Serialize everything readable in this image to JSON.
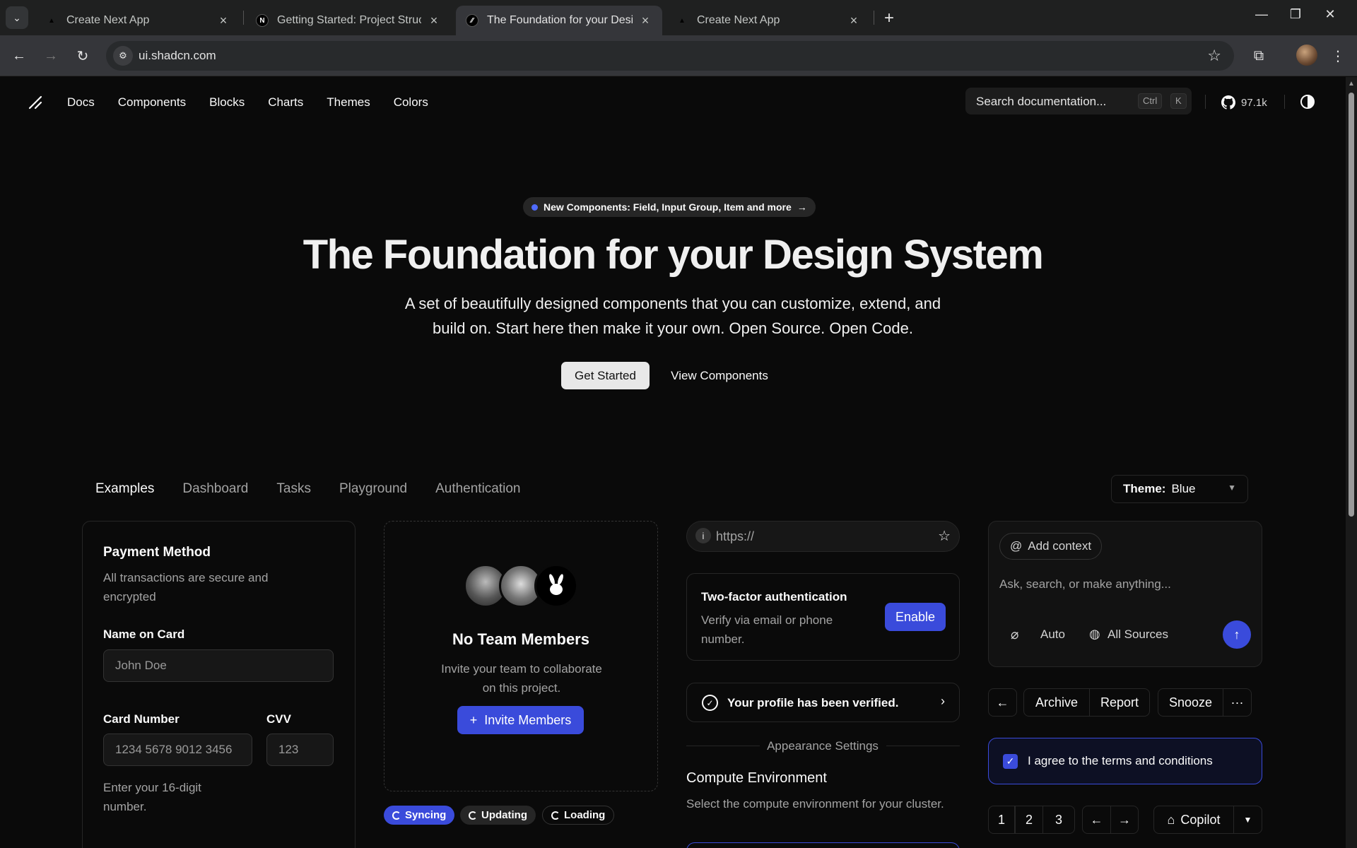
{
  "browser": {
    "tabs": [
      {
        "title": "Create Next App"
      },
      {
        "title": "Getting Started: Project Structure"
      },
      {
        "title": "The Foundation for your Design System"
      },
      {
        "title": "Create Next App"
      }
    ],
    "url": "ui.shadcn.com"
  },
  "site": {
    "nav": [
      "Docs",
      "Components",
      "Blocks",
      "Charts",
      "Themes",
      "Colors"
    ],
    "search_placeholder": "Search documentation...",
    "kbd_ctrl": "Ctrl",
    "kbd_k": "K",
    "github_stars": "97.1k"
  },
  "hero": {
    "announcement": "New Components: Field, Input Group, Item and more",
    "title": "The Foundation for your Design System",
    "subtitle": "A set of beautifully designed components that you can customize, extend, and build on. Start here then make it your own. Open Source. Open Code.",
    "primary_cta": "Get Started",
    "secondary_cta": "View Components"
  },
  "examples": {
    "tabs": [
      "Examples",
      "Dashboard",
      "Tasks",
      "Playground",
      "Authentication"
    ],
    "theme_label": "Theme:",
    "theme_value": "Blue"
  },
  "payment": {
    "title": "Payment Method",
    "description": "All transactions are secure and encrypted",
    "name_label": "Name on Card",
    "name_placeholder": "John Doe",
    "card_label": "Card Number",
    "card_placeholder": "1234 5678 9012 3456",
    "cvv_label": "CVV",
    "cvv_placeholder": "123",
    "card_hint": "Enter your 16-digit number."
  },
  "team": {
    "title": "No Team Members",
    "description": "Invite your team to collaborate on this project.",
    "invite_button": "Invite Members",
    "badges": [
      "Syncing",
      "Updating",
      "Loading"
    ]
  },
  "middle": {
    "url_input": "https://",
    "twofa_title": "Two-factor authentication",
    "twofa_desc": "Verify via email or phone number.",
    "twofa_button": "Enable",
    "verified_text": "Your profile has been verified.",
    "separator": "Appearance Settings",
    "compute_title": "Compute Environment",
    "compute_desc": "Select the compute environment for your cluster."
  },
  "prompt": {
    "add_context": "Add context",
    "placeholder": "Ask, search, or make anything...",
    "mode": "Auto",
    "sources": "All Sources"
  },
  "actions": {
    "archive": "Archive",
    "report": "Report",
    "snooze": "Snooze",
    "terms": "I agree to the terms and conditions",
    "pages": [
      "1",
      "2",
      "3"
    ],
    "copilot": "Copilot"
  },
  "colors": {
    "accent_blue": "#3a4bdb",
    "background": "#0a0a0a"
  }
}
